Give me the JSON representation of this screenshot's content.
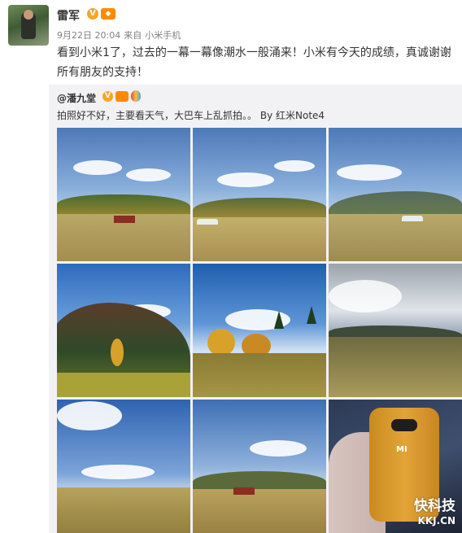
{
  "post": {
    "author": "雷军",
    "date": "9月22日 20:04",
    "via_label": "来自",
    "client": "小米手机",
    "text": "看到小米1了，过去的一幕一幕像潮水一般涌来！小米有今天的成绩，真诚谢谢所有朋友的支持！"
  },
  "repost": {
    "author": "@潘九堂",
    "text": "拍照好不好，主要看天气，大巴车上乱抓拍。。",
    "via": "By",
    "client": "红米Note4"
  },
  "badges": {
    "verified": "V"
  },
  "photos": [
    {
      "id": 1,
      "subject": "landscape with barn"
    },
    {
      "id": 2,
      "subject": "landscape with white barn"
    },
    {
      "id": 3,
      "subject": "mountain pasture"
    },
    {
      "id": 4,
      "subject": "forest hillside"
    },
    {
      "id": 5,
      "subject": "autumn trees"
    },
    {
      "id": 6,
      "subject": "cloudy valley"
    },
    {
      "id": 7,
      "subject": "blue sky field"
    },
    {
      "id": 8,
      "subject": "ranch buildings"
    },
    {
      "id": 9,
      "subject": "orange Mi phone in hand"
    }
  ],
  "watermark": {
    "brand": "快科技",
    "domain": "KKJ.CN"
  },
  "colors": {
    "repost_bg": "#f2f2f5",
    "meta": "#808080",
    "badge": "#f5a623"
  }
}
